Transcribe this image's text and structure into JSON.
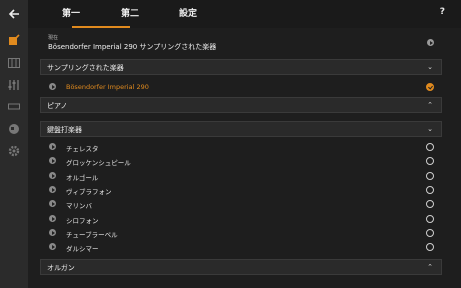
{
  "tabs": [
    {
      "label": "第一"
    },
    {
      "label": "第二"
    },
    {
      "label": "設定"
    }
  ],
  "help_label": "?",
  "current": {
    "label": "現在",
    "value": "Bösendorfer Imperial 290  サンプリングされた楽器"
  },
  "sections": {
    "sampled": {
      "title": "サンプリングされた楽器",
      "chevron": "⌄",
      "items": [
        {
          "label": "Bösendorfer Imperial 290"
        }
      ]
    },
    "piano": {
      "title": "ピアノ",
      "chevron": "⌃"
    },
    "keyboard": {
      "title": "鍵盤打楽器",
      "chevron": "⌄",
      "items": [
        {
          "label": "チェレスタ"
        },
        {
          "label": "グロッケンシュピール"
        },
        {
          "label": "オルゴール"
        },
        {
          "label": "ヴィブラフォン"
        },
        {
          "label": "マリンバ"
        },
        {
          "label": "シロフォン"
        },
        {
          "label": "チューブラーベル"
        },
        {
          "label": "ダルシマー"
        }
      ]
    },
    "organ": {
      "title": "オルガン",
      "chevron": "⌃"
    }
  },
  "colors": {
    "accent": "#e08a1e",
    "background": "#1e1e1e"
  },
  "icons": [
    "back-arrow-icon",
    "instrument-edit-icon",
    "keyboard-icon",
    "mixer-icon",
    "sequencer-icon",
    "globe-icon",
    "settings-gear-icon"
  ]
}
